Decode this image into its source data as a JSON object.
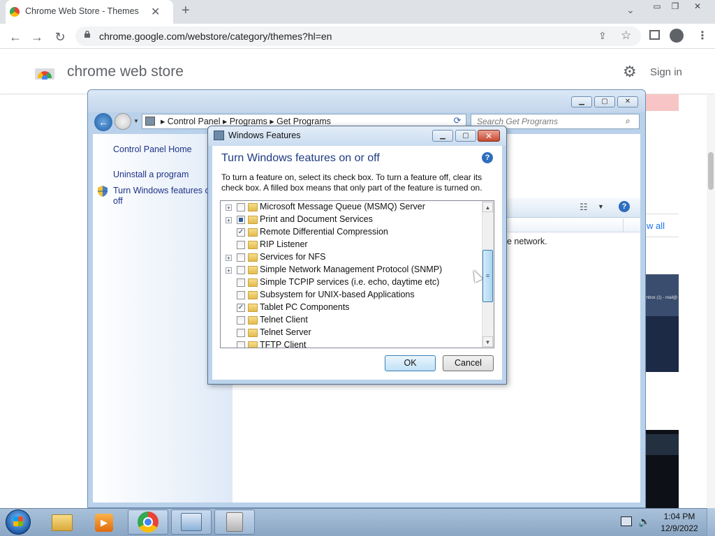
{
  "browser": {
    "tab_title": "Chrome Web Store - Themes",
    "url": "chrome.google.com/webstore/category/themes?hl=en",
    "icons": [
      "chrome-favicon",
      "close-icon",
      "plus-icon",
      "chevron-down-icon",
      "back-icon",
      "forward-icon",
      "reload-icon",
      "lock-icon",
      "share-icon",
      "star-icon",
      "side-panel-icon",
      "profile-icon",
      "menu-icon"
    ],
    "window_controls": {
      "minimize": "▭",
      "restore": "❐",
      "close": "✕"
    }
  },
  "store": {
    "title": "chrome web store",
    "sign_in": "Sign in",
    "view_all": "w all",
    "thumb_caption": "mbox (1) - mail@"
  },
  "control_panel": {
    "breadcrumb": "▸  Control Panel  ▸  Programs  ▸  Get Programs",
    "search_placeholder": "Search Get Programs",
    "links": {
      "home": "Control Panel Home",
      "uninstall": "Uninstall a program",
      "features_line1": "Turn Windows features on",
      "features_line2": "off"
    },
    "main_text": "he network."
  },
  "windows_features": {
    "title": "Windows Features",
    "heading": "Turn Windows features on or off",
    "description": "To turn a feature on, select its check box. To turn a feature off, clear its check box. A filled box means that only part of the feature is turned on.",
    "items": [
      {
        "label": "Microsoft Message Queue (MSMQ) Server",
        "state": "unchecked",
        "expandable": true
      },
      {
        "label": "Print and Document Services",
        "state": "partial",
        "expandable": true
      },
      {
        "label": "Remote Differential Compression",
        "state": "checked",
        "expandable": false
      },
      {
        "label": "RIP Listener",
        "state": "unchecked",
        "expandable": false
      },
      {
        "label": "Services for NFS",
        "state": "unchecked",
        "expandable": true
      },
      {
        "label": "Simple Network Management Protocol (SNMP)",
        "state": "unchecked",
        "expandable": true
      },
      {
        "label": "Simple TCPIP services (i.e. echo, daytime etc)",
        "state": "unchecked",
        "expandable": false
      },
      {
        "label": "Subsystem for UNIX-based Applications",
        "state": "unchecked",
        "expandable": false
      },
      {
        "label": "Tablet PC Components",
        "state": "checked",
        "expandable": false
      },
      {
        "label": "Telnet Client",
        "state": "unchecked",
        "expandable": false
      },
      {
        "label": "Telnet Server",
        "state": "unchecked",
        "expandable": false
      },
      {
        "label": "TFTP Client",
        "state": "unchecked",
        "expandable": false
      }
    ],
    "ok_label": "OK",
    "cancel_label": "Cancel"
  },
  "taskbar": {
    "time": "1:04 PM",
    "date": "12/9/2022",
    "apps": [
      "windows-explorer",
      "media-player",
      "google-chrome",
      "control-panel",
      "tool"
    ]
  },
  "colors": {
    "accent_blue": "#1a73e8",
    "win_link": "#1e3287",
    "win_heading": "#1e3b80"
  }
}
